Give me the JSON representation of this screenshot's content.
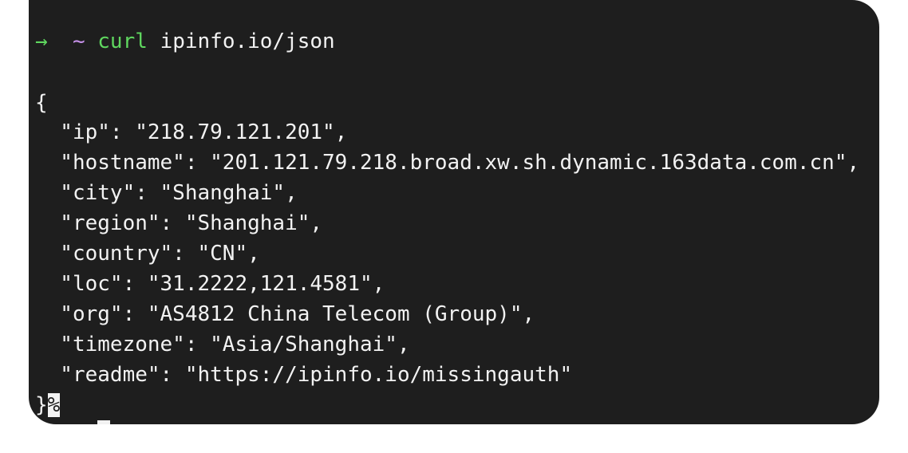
{
  "prompt": {
    "arrow": "→",
    "dir": "~",
    "command": "curl",
    "args": "ipinfo.io/json"
  },
  "output": {
    "open_brace": "{",
    "lines": [
      "  \"ip\": \"218.79.121.201\",",
      "  \"hostname\": \"201.121.79.218.broad.xw.sh.dynamic.163data.com.cn\",",
      "  \"city\": \"Shanghai\",",
      "  \"region\": \"Shanghai\",",
      "  \"country\": \"CN\",",
      "  \"loc\": \"31.2222,121.4581\",",
      "  \"org\": \"AS4812 China Telecom (Group)\",",
      "  \"timezone\": \"Asia/Shanghai\",",
      "  \"readme\": \"https://ipinfo.io/missingauth\""
    ],
    "close_brace": "}",
    "no_newline_marker": "%"
  },
  "colors": {
    "background": "#1e1e1e",
    "text": "#f2f2f2",
    "prompt_green": "#5fd75f",
    "prompt_purple": "#c792ea"
  }
}
